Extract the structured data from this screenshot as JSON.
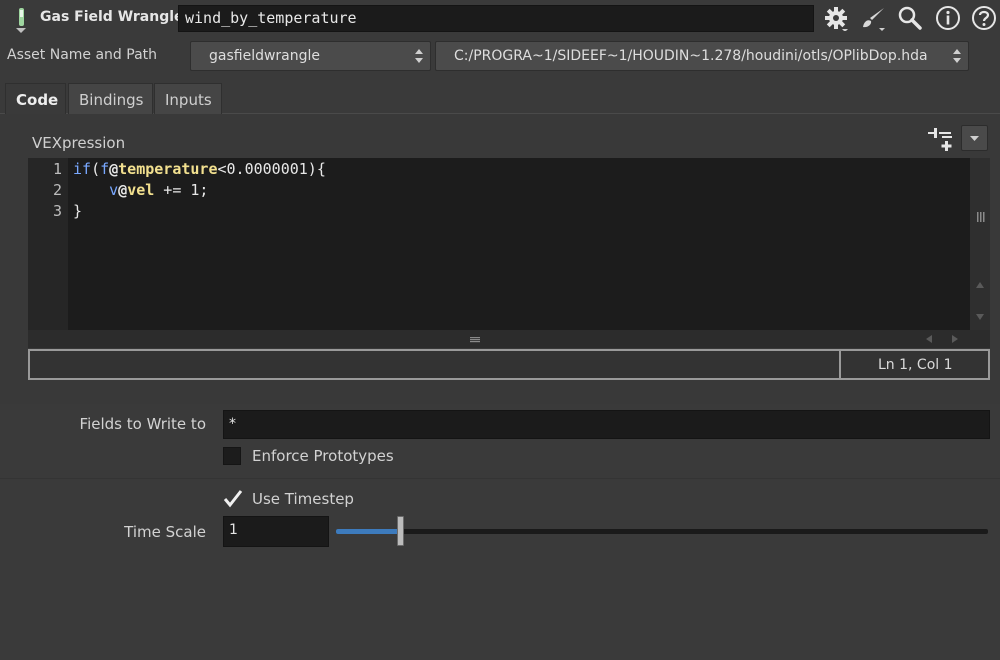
{
  "header": {
    "node_type": "Gas Field Wrangle",
    "node_name": "wind_by_temperature",
    "icons": [
      "gear-icon",
      "paint-brush-icon",
      "search-icon",
      "info-icon",
      "help-icon"
    ]
  },
  "asset": {
    "label": "Asset Name and Path",
    "name": "gasfieldwrangle",
    "path": "C:/PROGRA~1/SIDEEF~1/HOUDIN~1.278/houdini/otls/OPlibDop.hda"
  },
  "tabs": [
    {
      "label": "Code",
      "active": true
    },
    {
      "label": "Bindings",
      "active": false
    },
    {
      "label": "Inputs",
      "active": false
    }
  ],
  "vexpression": {
    "label": "VEXpression",
    "line_numbers": [
      "1",
      "2",
      "3"
    ],
    "lines": [
      "if(f@temperature<0.0000001){",
      "    v@vel += 1;",
      "}"
    ],
    "cursor_position": "Ln 1, Col 1"
  },
  "params": {
    "fields_to_write_label": "Fields to Write to",
    "fields_to_write_value": "*",
    "enforce_prototypes_label": "Enforce Prototypes",
    "enforce_prototypes_checked": false,
    "use_timestep_label": "Use Timestep",
    "use_timestep_checked": true,
    "time_scale_label": "Time Scale",
    "time_scale_value": "1",
    "time_scale_slider_fraction": 0.1
  },
  "colors": {
    "background": "#3a3a3a",
    "field": "#1b1b1b",
    "keyword": "#79a8ff",
    "attribute": "#f2e08f",
    "slider_fill": "#3d7bbd"
  }
}
